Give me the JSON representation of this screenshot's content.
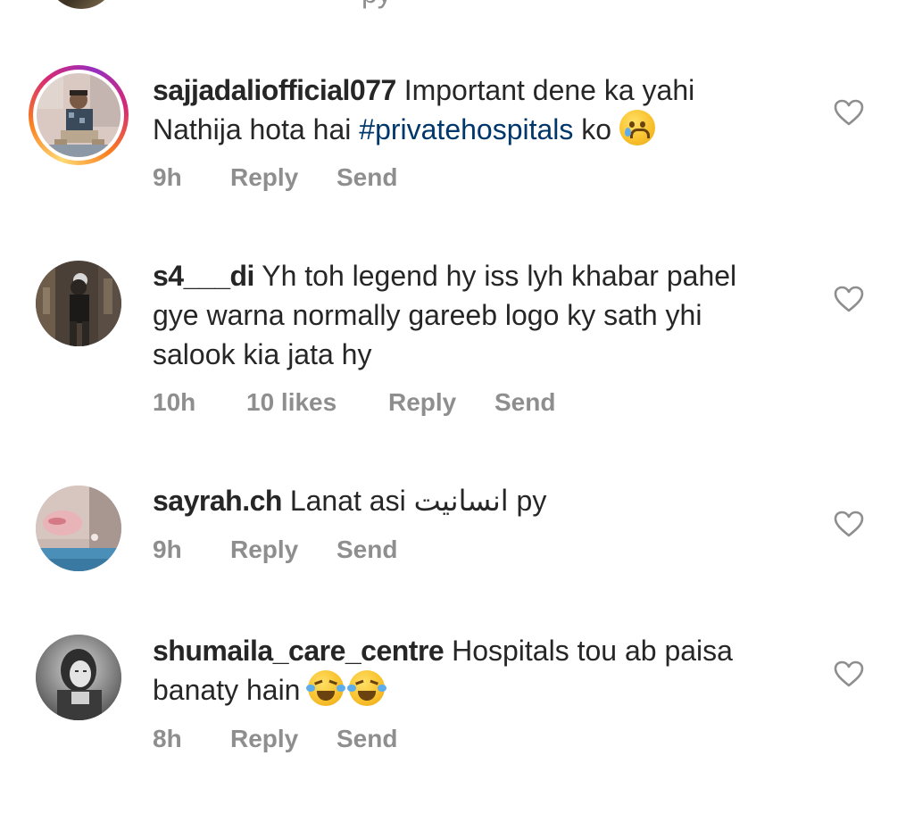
{
  "top_partial": {
    "text": "py"
  },
  "comments": [
    {
      "username": "sajjadaliofficial077",
      "text_part1": "Important dene ka yahi Nathija hota hai ",
      "hashtag": "#privatehospitals",
      "text_part2": " ko ",
      "emoji": "crying-face",
      "time": "9h",
      "likes": "",
      "reply_label": "Reply",
      "send_label": "Send",
      "has_story_ring": true
    },
    {
      "username": "s4___di",
      "text_part1": "Yh toh legend hy iss lyh khabar pahel gye warna normally gareeb logo ky sath yhi salook kia jata hy",
      "time": "10h",
      "likes": "10 likes",
      "reply_label": "Reply",
      "send_label": "Send",
      "has_story_ring": false
    },
    {
      "username": "sayrah.ch",
      "text_part1": "Lanat asi انسانیت py",
      "time": "9h",
      "likes": "",
      "reply_label": "Reply",
      "send_label": "Send",
      "has_story_ring": false
    },
    {
      "username": "shumaila_care_centre",
      "text_part1": "Hospitals tou ab paisa banaty hain ",
      "emoji": "face-with-tears-of-joy x2",
      "time": "8h",
      "likes": "",
      "reply_label": "Reply",
      "send_label": "Send",
      "has_story_ring": false
    }
  ],
  "colors": {
    "text": "#262626",
    "meta": "#8e8e8e",
    "hashtag": "#00376b",
    "background": "#ffffff"
  },
  "icons": {
    "like": "heart-outline-icon"
  }
}
